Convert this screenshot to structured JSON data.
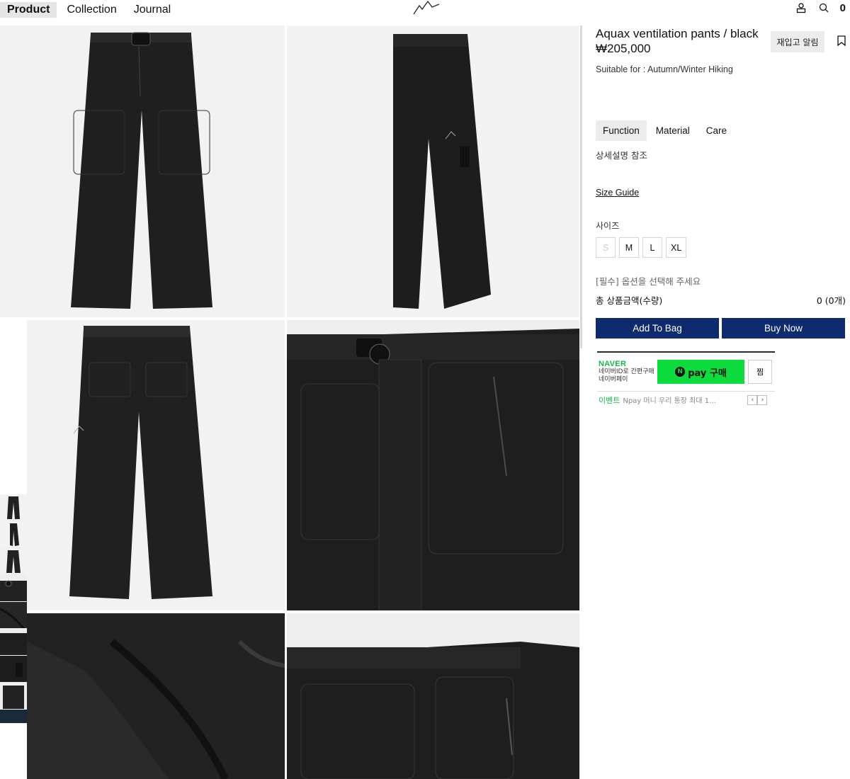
{
  "nav": {
    "items": [
      "Product",
      "Collection",
      "Journal"
    ],
    "cart_count": "0"
  },
  "icons": {
    "logo": "mountain-logo",
    "account": "user-icon",
    "search": "search-icon",
    "bookmark": "bookmark-icon"
  },
  "product": {
    "title": "Aquax ventilation pants / black",
    "price": "₩205,000",
    "suitable": "Suitable for : Autumn/Winter Hiking",
    "restock_label": "재입고 알림"
  },
  "tabs": {
    "items": [
      "Function",
      "Material",
      "Care"
    ],
    "content": "상세설명 참조"
  },
  "size_guide": "Size Guide",
  "size": {
    "label": "사이즈",
    "options": [
      "S",
      "M",
      "L",
      "XL"
    ]
  },
  "required_text": "[필수] 옵션을 선택해 주세요",
  "total": {
    "label": "총 상품금액(수량)",
    "value": "0 (0개)"
  },
  "buttons": {
    "add_to_bag": "Add To Bag",
    "buy_now": "Buy Now"
  },
  "naver": {
    "logo": "NAVER",
    "line1": "네이버ID로 간편구매",
    "line2": "네이버페이",
    "npay_n": "N",
    "npay_label": "pay 구매",
    "zzim": "찜",
    "event_label": "이벤트",
    "event_text": "Npay 머니 우리 통장 최대 1…",
    "prev": "‹",
    "next": "›"
  },
  "colors": {
    "primary_button": "#0d2b6e",
    "npay_green": "#0ddc3f",
    "naver_green": "#19b84b",
    "tab_active_bg": "#ececec"
  }
}
